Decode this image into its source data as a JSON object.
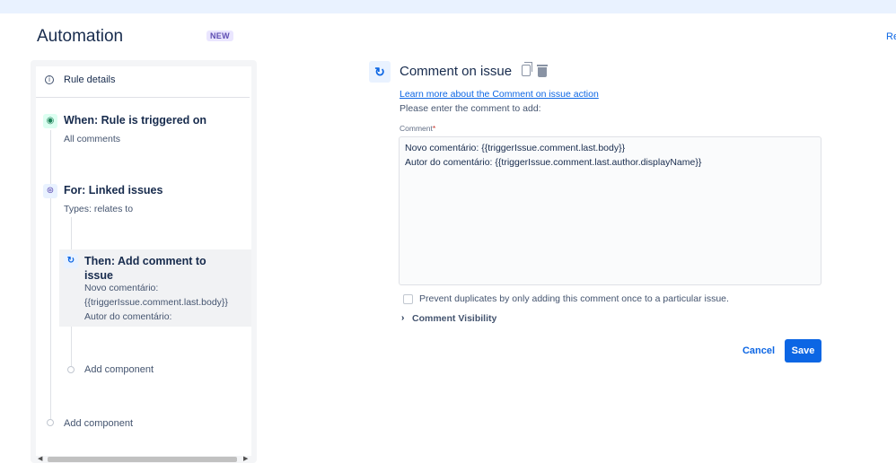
{
  "header": {
    "title": "Automation",
    "badge": "NEW",
    "right_link": "Re"
  },
  "sidebar": {
    "rule_details": "Rule details",
    "trigger": {
      "title": "When: Rule is triggered on",
      "subtitle": "All comments"
    },
    "branch": {
      "title": "For: Linked issues",
      "subtitle": "Types: relates to"
    },
    "action": {
      "title": "Then: Add comment to issue",
      "lines": [
        "Novo comentário:",
        "{{triggerIssue.comment.last.body}}",
        "Autor do comentário:"
      ]
    },
    "add_component_inner": "Add component",
    "add_component_outer": "Add component"
  },
  "editor": {
    "title": "Comment on issue",
    "learn_more": "Learn more about the Comment on issue action",
    "instruction": "Please enter the comment to add:",
    "comment_label": "Comment",
    "comment_required": "*",
    "comment_lines": [
      "Novo comentário: {{triggerIssue.comment.last.body}}",
      "Autor do comentário: {{triggerIssue.comment.last.author.displayName}}"
    ],
    "prevent_duplicates": "Prevent duplicates by only adding this comment once to a particular issue.",
    "visibility": "Comment Visibility",
    "cancel": "Cancel",
    "save": "Save"
  }
}
